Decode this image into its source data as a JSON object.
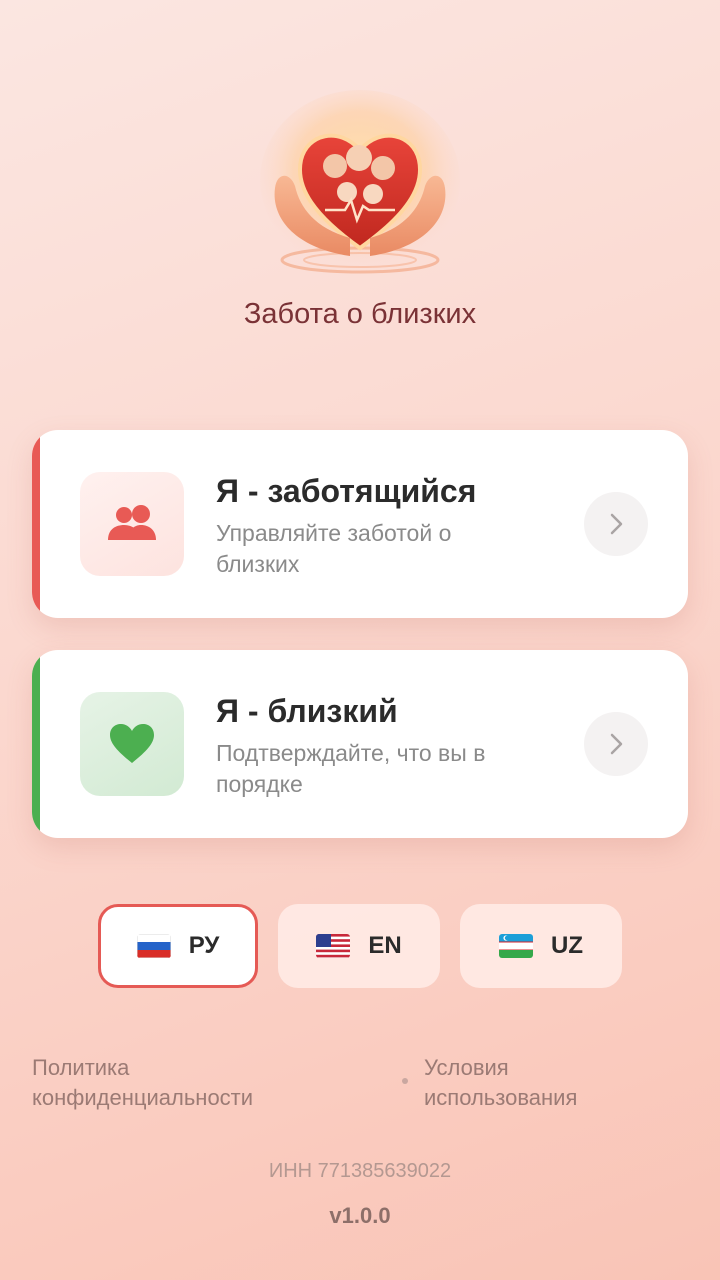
{
  "app": {
    "title": "Забота о близких",
    "logo_icon": "heart-hands-family-icon"
  },
  "roles": [
    {
      "title": "Я - заботящийся",
      "subtitle": "Управляйте заботой о близких",
      "icon": "people-icon",
      "accent": "#e85a55"
    },
    {
      "title": "Я - близкий",
      "subtitle": "Подтверждайте, что вы в порядке",
      "icon": "heart-icon",
      "accent": "#4caf50"
    }
  ],
  "languages": [
    {
      "code": "РУ",
      "flag": "ru-flag-icon",
      "selected": true
    },
    {
      "code": "EN",
      "flag": "us-flag-icon",
      "selected": false
    },
    {
      "code": "UZ",
      "flag": "uz-flag-icon",
      "selected": false
    }
  ],
  "footer": {
    "privacy": "Политика конфиденциальности",
    "terms": "Условия использования",
    "inn": "ИНН 771385639022",
    "version": "v1.0.0"
  }
}
